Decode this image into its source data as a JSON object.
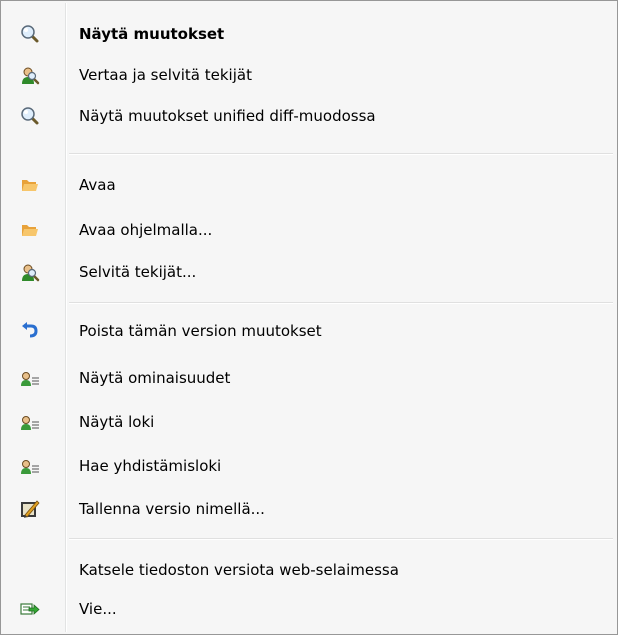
{
  "menu": {
    "items": [
      {
        "label": "Näytä muutokset",
        "icon": "magnifier-icon"
      },
      {
        "label": "Vertaa ja selvitä tekijät",
        "icon": "blame-user-icon"
      },
      {
        "label": "Näytä muutokset unified diff-muodossa",
        "icon": "magnifier-icon"
      },
      {
        "label": "Avaa",
        "icon": "folder-open-icon"
      },
      {
        "label": "Avaa ohjelmalla...",
        "icon": "folder-open-icon"
      },
      {
        "label": "Selvitä tekijät...",
        "icon": "blame-user-icon"
      },
      {
        "label": "Poista tämän version muutokset",
        "icon": "undo-arrow-icon"
      },
      {
        "label": "Näytä ominaisuudet",
        "icon": "user-properties-icon"
      },
      {
        "label": "Näytä loki",
        "icon": "user-properties-icon"
      },
      {
        "label": "Hae yhdistämisloki",
        "icon": "user-properties-icon"
      },
      {
        "label": "Tallenna versio nimellä...",
        "icon": "save-as-pencil-icon"
      },
      {
        "label": "Katsele tiedoston versiota web-selaimessa",
        "icon": ""
      },
      {
        "label": "Vie...",
        "icon": "export-icon"
      }
    ]
  }
}
